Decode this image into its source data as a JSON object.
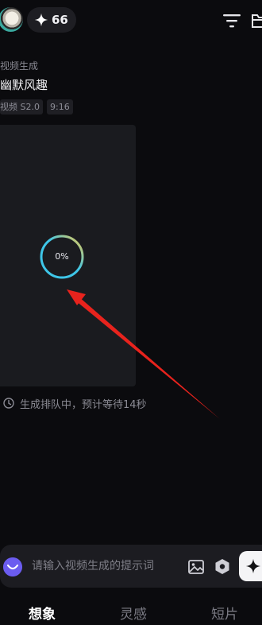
{
  "header": {
    "avatar_icon": "user-avatar-icon",
    "credits": {
      "icon": "sparkle-star-icon",
      "count": "66"
    },
    "filter_icon": "filter-lines-icon",
    "folder_icon": "folder-icon"
  },
  "task": {
    "category": "视频生成",
    "title": "幽默风趣",
    "tags": [
      "视频 S2.0",
      "9:16"
    ],
    "progress_percent": 0,
    "progress_label": "0%",
    "queue_status": "生成排队中，预计等待14秒"
  },
  "annotation": {
    "type": "red-arrow",
    "color": "#e8231d"
  },
  "prompt": {
    "placeholder": "请输入视频生成的提示词",
    "value": "",
    "icons": [
      "mascot-icon",
      "image-icon",
      "hexagon-settings-icon",
      "sparkle-generate-icon"
    ]
  },
  "tabs": [
    {
      "label": "想象",
      "active": true
    },
    {
      "label": "灵感",
      "active": false
    },
    {
      "label": "短片",
      "active": false
    }
  ],
  "colors": {
    "background": "#0b0b0e",
    "card": "#1a1b1f",
    "ring_gradient": [
      "#3ec6e8",
      "#f2c94c"
    ],
    "accent_purple": "#6b5cf0"
  }
}
